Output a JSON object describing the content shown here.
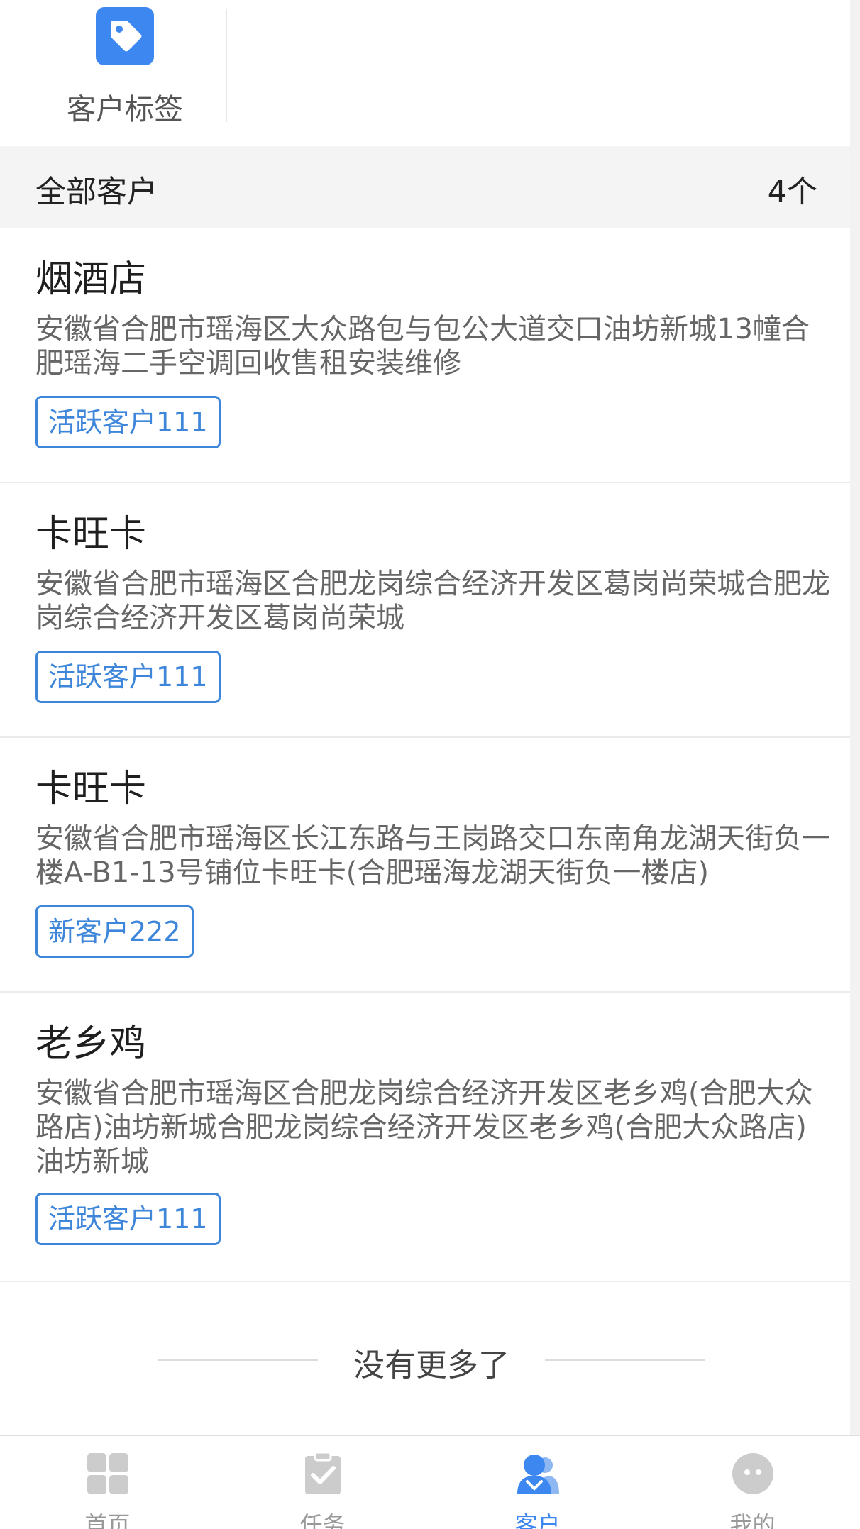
{
  "quick_entries": [
    {
      "label": "客户标签",
      "icon": "tag-icon"
    }
  ],
  "section": {
    "title": "全部客户",
    "count": "4个"
  },
  "customers": [
    {
      "name": "烟酒店",
      "address": "安徽省合肥市瑶海区大众路包与包公大道交口油坊新城13幢合肥瑶海二手空调回收售租安装维修",
      "tag": "活跃客户111"
    },
    {
      "name": "卡旺卡",
      "address": "安徽省合肥市瑶海区合肥龙岗综合经济开发区葛岗尚荣城合肥龙岗综合经济开发区葛岗尚荣城",
      "tag": "活跃客户111"
    },
    {
      "name": "卡旺卡",
      "address": "安徽省合肥市瑶海区长江东路与王岗路交口东南角龙湖天街负一楼A-B1-13号铺位卡旺卡(合肥瑶海龙湖天街负一楼店)",
      "tag": "新客户222"
    },
    {
      "name": "老乡鸡",
      "address": "安徽省合肥市瑶海区合肥龙岗综合经济开发区老乡鸡(合肥大众路店)油坊新城合肥龙岗综合经济开发区老乡鸡(合肥大众路店)油坊新城",
      "tag": "活跃客户111"
    }
  ],
  "list_footer": "没有更多了",
  "tabbar": [
    {
      "label": "首页",
      "icon": "home-grid-icon",
      "active": false
    },
    {
      "label": "任务",
      "icon": "clipboard-check-icon",
      "active": false
    },
    {
      "label": "客户",
      "icon": "customers-icon",
      "active": true
    },
    {
      "label": "我的",
      "icon": "profile-face-icon",
      "active": false
    }
  ],
  "colors": {
    "accent": "#3c87f0",
    "tag_border": "#3d86da",
    "inactive_icon": "#cccccc"
  }
}
